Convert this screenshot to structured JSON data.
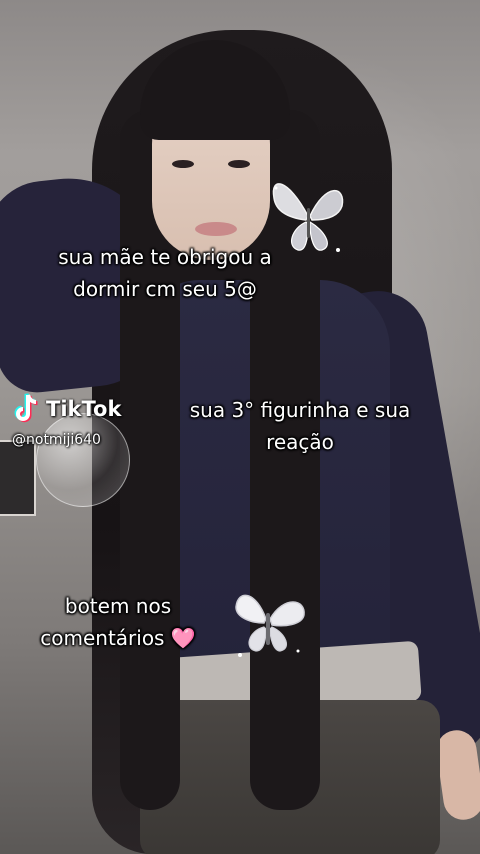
{
  "captions": {
    "first": "sua mãe te obrigou a\ndormir cm seu 5@",
    "first_line1": "sua mãe te obrigou a",
    "first_line2": "dormir cm seu 5@",
    "second_line1": "sua 3° figurinha e sua",
    "second_line2": "reação",
    "third_line1": "botem nos",
    "third_line2": "comentários",
    "heart": "🩷"
  },
  "watermark": {
    "brand": "TikTok",
    "handle": "@notmiji640"
  },
  "decorations": {
    "butterfly_top_icon": "butterfly-icon",
    "butterfly_bottom_icon": "butterfly-icon",
    "bubble_icon": "bubble-sticker"
  },
  "colors": {
    "caption_text": "#ffffff",
    "tiktok_cyan": "#25f4ee",
    "tiktok_red": "#fe2c55"
  }
}
